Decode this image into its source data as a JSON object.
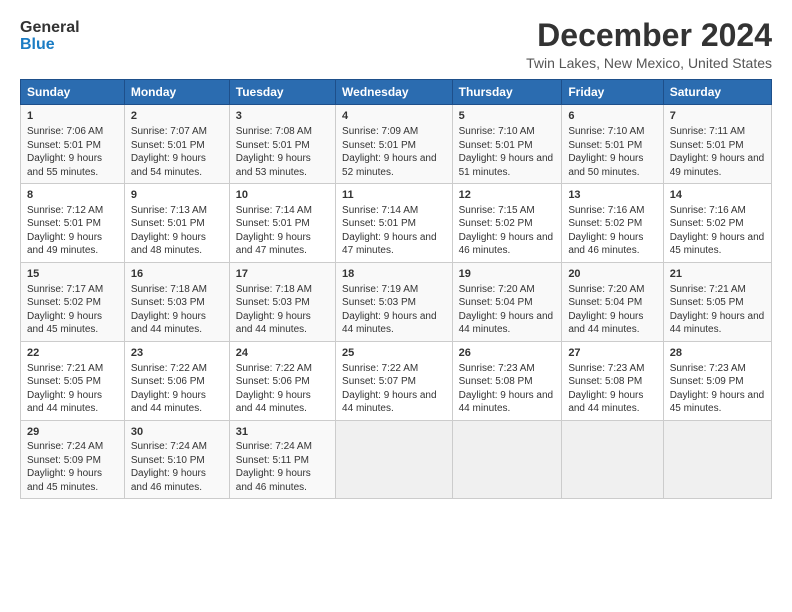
{
  "logo": {
    "line1": "General",
    "line2": "Blue"
  },
  "title": "December 2024",
  "subtitle": "Twin Lakes, New Mexico, United States",
  "weekdays": [
    "Sunday",
    "Monday",
    "Tuesday",
    "Wednesday",
    "Thursday",
    "Friday",
    "Saturday"
  ],
  "weeks": [
    [
      {
        "day": "1",
        "sunrise": "7:06 AM",
        "sunset": "5:01 PM",
        "daylight": "9 hours and 55 minutes."
      },
      {
        "day": "2",
        "sunrise": "7:07 AM",
        "sunset": "5:01 PM",
        "daylight": "9 hours and 54 minutes."
      },
      {
        "day": "3",
        "sunrise": "7:08 AM",
        "sunset": "5:01 PM",
        "daylight": "9 hours and 53 minutes."
      },
      {
        "day": "4",
        "sunrise": "7:09 AM",
        "sunset": "5:01 PM",
        "daylight": "9 hours and 52 minutes."
      },
      {
        "day": "5",
        "sunrise": "7:10 AM",
        "sunset": "5:01 PM",
        "daylight": "9 hours and 51 minutes."
      },
      {
        "day": "6",
        "sunrise": "7:10 AM",
        "sunset": "5:01 PM",
        "daylight": "9 hours and 50 minutes."
      },
      {
        "day": "7",
        "sunrise": "7:11 AM",
        "sunset": "5:01 PM",
        "daylight": "9 hours and 49 minutes."
      }
    ],
    [
      {
        "day": "8",
        "sunrise": "7:12 AM",
        "sunset": "5:01 PM",
        "daylight": "9 hours and 49 minutes."
      },
      {
        "day": "9",
        "sunrise": "7:13 AM",
        "sunset": "5:01 PM",
        "daylight": "9 hours and 48 minutes."
      },
      {
        "day": "10",
        "sunrise": "7:14 AM",
        "sunset": "5:01 PM",
        "daylight": "9 hours and 47 minutes."
      },
      {
        "day": "11",
        "sunrise": "7:14 AM",
        "sunset": "5:01 PM",
        "daylight": "9 hours and 47 minutes."
      },
      {
        "day": "12",
        "sunrise": "7:15 AM",
        "sunset": "5:02 PM",
        "daylight": "9 hours and 46 minutes."
      },
      {
        "day": "13",
        "sunrise": "7:16 AM",
        "sunset": "5:02 PM",
        "daylight": "9 hours and 46 minutes."
      },
      {
        "day": "14",
        "sunrise": "7:16 AM",
        "sunset": "5:02 PM",
        "daylight": "9 hours and 45 minutes."
      }
    ],
    [
      {
        "day": "15",
        "sunrise": "7:17 AM",
        "sunset": "5:02 PM",
        "daylight": "9 hours and 45 minutes."
      },
      {
        "day": "16",
        "sunrise": "7:18 AM",
        "sunset": "5:03 PM",
        "daylight": "9 hours and 44 minutes."
      },
      {
        "day": "17",
        "sunrise": "7:18 AM",
        "sunset": "5:03 PM",
        "daylight": "9 hours and 44 minutes."
      },
      {
        "day": "18",
        "sunrise": "7:19 AM",
        "sunset": "5:03 PM",
        "daylight": "9 hours and 44 minutes."
      },
      {
        "day": "19",
        "sunrise": "7:20 AM",
        "sunset": "5:04 PM",
        "daylight": "9 hours and 44 minutes."
      },
      {
        "day": "20",
        "sunrise": "7:20 AM",
        "sunset": "5:04 PM",
        "daylight": "9 hours and 44 minutes."
      },
      {
        "day": "21",
        "sunrise": "7:21 AM",
        "sunset": "5:05 PM",
        "daylight": "9 hours and 44 minutes."
      }
    ],
    [
      {
        "day": "22",
        "sunrise": "7:21 AM",
        "sunset": "5:05 PM",
        "daylight": "9 hours and 44 minutes."
      },
      {
        "day": "23",
        "sunrise": "7:22 AM",
        "sunset": "5:06 PM",
        "daylight": "9 hours and 44 minutes."
      },
      {
        "day": "24",
        "sunrise": "7:22 AM",
        "sunset": "5:06 PM",
        "daylight": "9 hours and 44 minutes."
      },
      {
        "day": "25",
        "sunrise": "7:22 AM",
        "sunset": "5:07 PM",
        "daylight": "9 hours and 44 minutes."
      },
      {
        "day": "26",
        "sunrise": "7:23 AM",
        "sunset": "5:08 PM",
        "daylight": "9 hours and 44 minutes."
      },
      {
        "day": "27",
        "sunrise": "7:23 AM",
        "sunset": "5:08 PM",
        "daylight": "9 hours and 44 minutes."
      },
      {
        "day": "28",
        "sunrise": "7:23 AM",
        "sunset": "5:09 PM",
        "daylight": "9 hours and 45 minutes."
      }
    ],
    [
      {
        "day": "29",
        "sunrise": "7:24 AM",
        "sunset": "5:09 PM",
        "daylight": "9 hours and 45 minutes."
      },
      {
        "day": "30",
        "sunrise": "7:24 AM",
        "sunset": "5:10 PM",
        "daylight": "9 hours and 46 minutes."
      },
      {
        "day": "31",
        "sunrise": "7:24 AM",
        "sunset": "5:11 PM",
        "daylight": "9 hours and 46 minutes."
      },
      null,
      null,
      null,
      null
    ]
  ],
  "labels": {
    "sunrise": "Sunrise:",
    "sunset": "Sunset:",
    "daylight": "Daylight:"
  }
}
